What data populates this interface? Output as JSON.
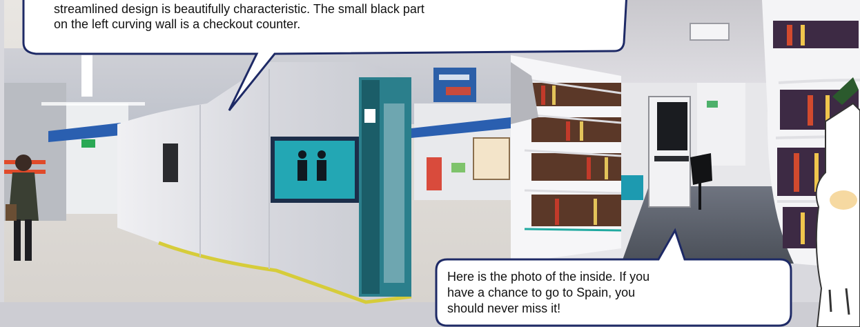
{
  "captions": {
    "top_bubble": {
      "line_1": "streamlined design is beautifully characteristic. The small black part",
      "line_2": "on the left curving wall is a checkout counter."
    },
    "bottom_bubble": {
      "line_1": "Here is the photo of the inside. If you",
      "line_2": "have a chance to go to Spain, you",
      "line_3": "should never miss it!"
    }
  }
}
